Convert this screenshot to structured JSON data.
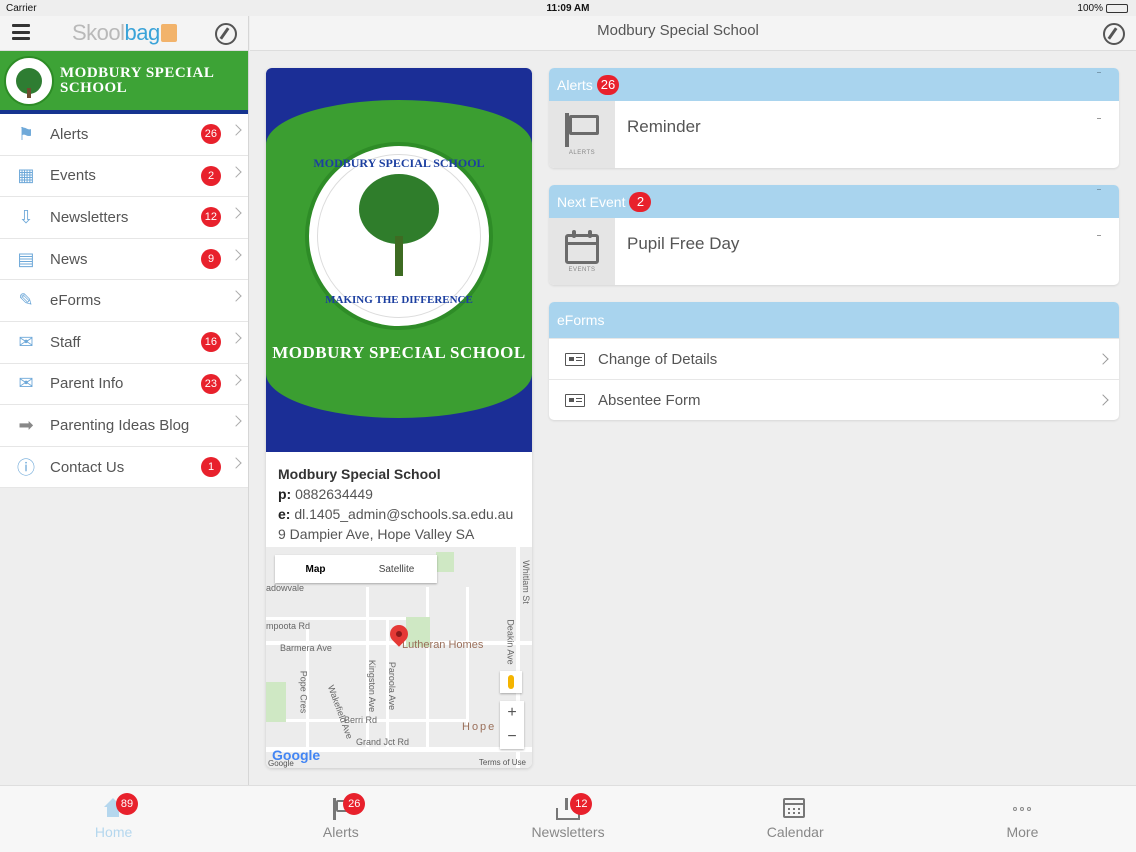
{
  "status": {
    "carrier": "Carrier",
    "time": "11:09 AM",
    "battery": "100%"
  },
  "sidebar": {
    "brand": {
      "part1": "Skool",
      "part2": "bag"
    },
    "school_name": "MODBURY SPECIAL SCHOOL",
    "items": [
      {
        "label": "Alerts",
        "badge": "26",
        "icon": "flag-icon"
      },
      {
        "label": "Events",
        "badge": "2",
        "icon": "calendar-icon"
      },
      {
        "label": "Newsletters",
        "badge": "12",
        "icon": "newsletter-tray-icon"
      },
      {
        "label": "News",
        "badge": "9",
        "icon": "document-icon"
      },
      {
        "label": "eForms",
        "badge": "",
        "icon": "form-edit-icon"
      },
      {
        "label": "Staff",
        "badge": "16",
        "icon": "envelope-icon"
      },
      {
        "label": "Parent Info",
        "badge": "23",
        "icon": "mail-icon"
      },
      {
        "label": "Parenting Ideas Blog",
        "badge": "",
        "icon": "arrow-right-icon"
      },
      {
        "label": "Contact Us",
        "badge": "1",
        "icon": "info-icon"
      }
    ]
  },
  "header": {
    "title": "Modbury Special School"
  },
  "school": {
    "seal_top": "MODBURY SPECIAL SCHOOL",
    "seal_bottom": "MAKING THE DIFFERENCE",
    "hero_name": "MODBURY SPECIAL SCHOOL",
    "name": "Modbury Special School",
    "phone_label": "p:",
    "phone": "0882634449",
    "email_label": "e:",
    "email": "dl.1405_admin@schools.sa.edu.au",
    "address": "9 Dampier Ave, Hope Valley SA"
  },
  "map": {
    "tab_map": "Map",
    "tab_satellite": "Satellite",
    "labels": [
      "Barmera Ave",
      "Kingston Ave",
      "Paroola Ave",
      "Pope Cres",
      "Wakefield Ave",
      "Berri Rd",
      "Grand Jct Rd",
      "Deakin Ave",
      "Whitlam St",
      "mpoota Rd",
      "adowvale"
    ],
    "place": "Lutheran Homes",
    "area": "Hope",
    "google": "Google",
    "terms": "Terms of Use",
    "zoom_in": "+",
    "zoom_out": "−"
  },
  "alerts_panel": {
    "title": "Alerts",
    "badge": "26",
    "tile_caption": "ALERTS",
    "item": "Reminder"
  },
  "event_panel": {
    "title": "Next Event",
    "badge": "2",
    "tile_caption": "EVENTS",
    "item": "Pupil Free Day"
  },
  "eforms_panel": {
    "title": "eForms",
    "items": [
      "Change of Details",
      "Absentee Form"
    ]
  },
  "tabbar": [
    {
      "label": "Home",
      "badge": "89"
    },
    {
      "label": "Alerts",
      "badge": "26"
    },
    {
      "label": "Newsletters",
      "badge": "12"
    },
    {
      "label": "Calendar",
      "badge": ""
    },
    {
      "label": "More",
      "badge": ""
    }
  ],
  "colors": {
    "accent": "#3aa3d8",
    "panel_header": "#a9d4ee",
    "badge": "#e8212c",
    "school_green": "#3da336",
    "school_blue": "#1b2e96"
  }
}
